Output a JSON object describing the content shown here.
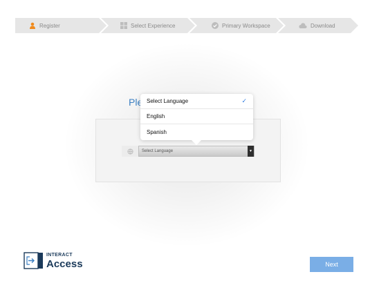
{
  "stepper": {
    "steps": [
      {
        "label": "Register",
        "icon": "user-icon",
        "color": "#f08a1c"
      },
      {
        "label": "Select Experience",
        "icon": "grid-icon"
      },
      {
        "label": "Primary Workspace",
        "icon": "check-circle-icon"
      },
      {
        "label": "Download",
        "icon": "cloud-icon"
      }
    ]
  },
  "heading": "Ple",
  "language_select": {
    "value": "Select Language",
    "icon": "globe-icon"
  },
  "dropdown": {
    "options": [
      {
        "label": "Select Language",
        "selected": true
      },
      {
        "label": "English",
        "selected": false
      },
      {
        "label": "Spanish",
        "selected": false
      }
    ],
    "check_color": "#2e7be0"
  },
  "logo": {
    "line1": "INTERACT",
    "line2": "Access"
  },
  "next_button": {
    "label": "Next",
    "color": "#7aaee6"
  }
}
